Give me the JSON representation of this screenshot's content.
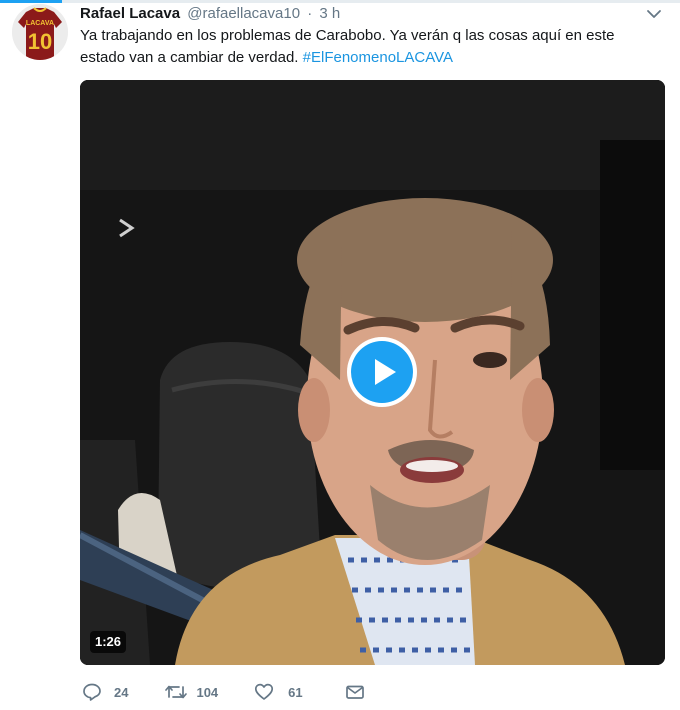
{
  "tweet": {
    "author_name": "Rafael Lacava",
    "handle": "@rafaellacava10",
    "separator": "·",
    "time": "3 h",
    "text_main": "Ya trabajando en los problemas de Carabobo. Ya verán q las cosas aquí en este estado van a cambiar de verdad.",
    "hashtag": "#ElFenomenoLACAVA"
  },
  "avatar": {
    "jersey_text": "LACAVA",
    "jersey_number": "10",
    "jersey_color": "#8b1a1a",
    "trim_color": "#f1c232"
  },
  "media": {
    "type": "video",
    "duration": "1:26",
    "play_color": "#1da1f2"
  },
  "actions": {
    "replies": "24",
    "retweets": "104",
    "likes": "61"
  },
  "colors": {
    "link": "#1b95e0",
    "muted": "#657786",
    "accent": "#1da1f2"
  }
}
